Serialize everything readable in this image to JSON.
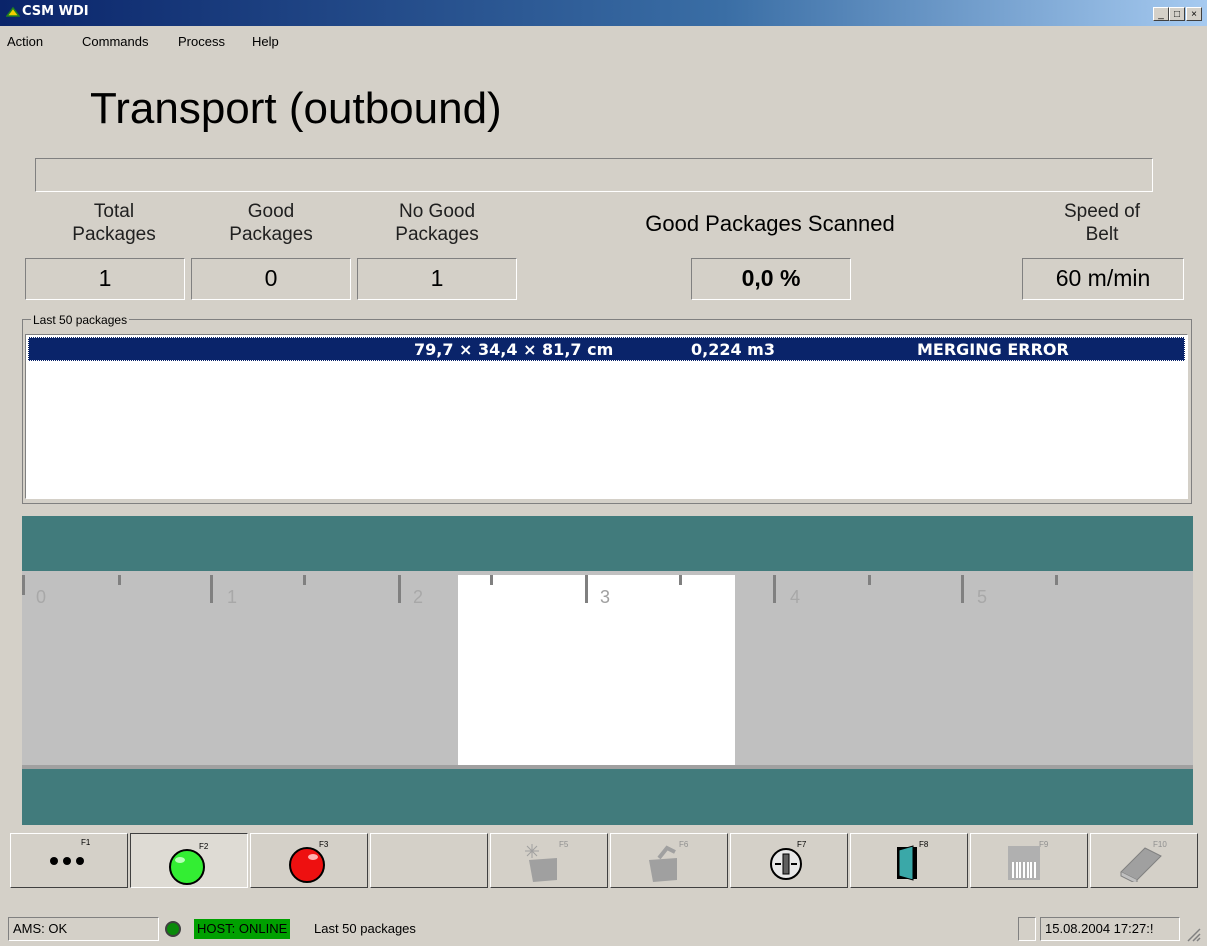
{
  "window": {
    "title": "CSM WDI"
  },
  "menu": {
    "items": [
      "Action",
      "Commands",
      "Process",
      "Help"
    ]
  },
  "page_title": "Transport (outbound)",
  "stats": {
    "total_label": [
      "Total",
      "Packages"
    ],
    "total_value": "1",
    "good_label": [
      "Good",
      "Packages"
    ],
    "good_value": "0",
    "nogood_label": [
      "No Good",
      "Packages"
    ],
    "nogood_value": "1",
    "scanned_label": "Good Packages Scanned",
    "scanned_value": "0,0 %",
    "speed_label": [
      "Speed of",
      "Belt"
    ],
    "speed_value": "60 m/min"
  },
  "packages_list": {
    "caption": "Last 50 packages",
    "rows": [
      {
        "dimensions": "79,7 × 34,4 × 81,7 cm",
        "volume": "0,224 m3",
        "status": "MERGING ERROR"
      }
    ]
  },
  "conveyor": {
    "scale_labels": [
      "0",
      "1",
      "2",
      "3",
      "4",
      "5"
    ],
    "colors": {
      "rail": "#417b7c",
      "belt": "#c0c0c0",
      "package": "#ffffff"
    }
  },
  "function_keys": [
    {
      "key": "F1",
      "icon": "dots-icon",
      "enabled": true
    },
    {
      "key": "F2",
      "icon": "green-light-icon",
      "enabled": true,
      "pressed": true
    },
    {
      "key": "F3",
      "icon": "red-light-icon",
      "enabled": true
    },
    {
      "key": "",
      "icon": "",
      "enabled": false
    },
    {
      "key": "F5",
      "icon": "package-scan-icon",
      "enabled": false
    },
    {
      "key": "F6",
      "icon": "package-arm-icon",
      "enabled": false
    },
    {
      "key": "F7",
      "icon": "network-icon",
      "enabled": true
    },
    {
      "key": "F8",
      "icon": "exit-door-icon",
      "enabled": true
    },
    {
      "key": "F9",
      "icon": "barcode-icon",
      "enabled": false
    },
    {
      "key": "F10",
      "icon": "book-icon",
      "enabled": false
    }
  ],
  "status_bar": {
    "ams": "AMS: OK",
    "host": "HOST: ONLINE",
    "host_color": "#00a000",
    "message": "Last 50 packages",
    "datetime": "15.08.2004 17:27:!"
  }
}
